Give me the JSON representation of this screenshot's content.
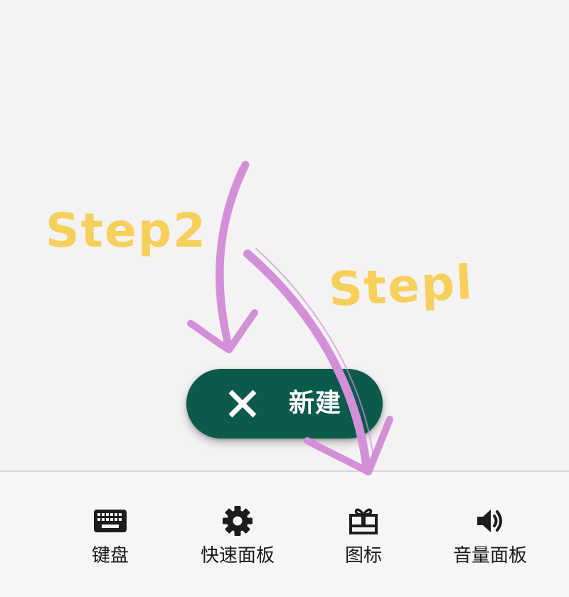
{
  "fab": {
    "label": "新建",
    "icon": "close-icon",
    "background": "#0b5a4b"
  },
  "annotations": {
    "step1": "Stepl",
    "step2": "Step2",
    "label_color": "#f7cf5b",
    "arrow_color": "#d38fd8"
  },
  "toolbar": {
    "items": [
      {
        "label": "键盘",
        "icon": "keyboard-icon"
      },
      {
        "label": "快速面板",
        "icon": "gear-icon"
      },
      {
        "label": "图标",
        "icon": "gift-icon"
      },
      {
        "label": "音量面板",
        "icon": "volume-icon"
      }
    ]
  }
}
